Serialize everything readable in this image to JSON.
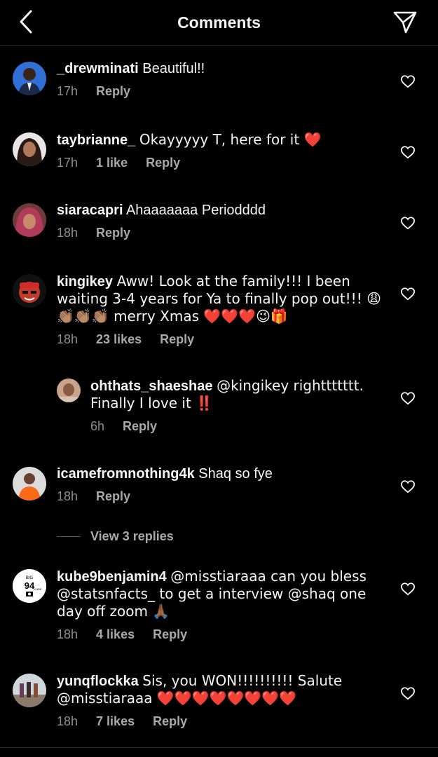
{
  "header": {
    "title": "Comments",
    "back_icon": "chevron-left-icon",
    "send_icon": "paper-plane-icon"
  },
  "comments": [
    {
      "username": "_drewminati",
      "text": "Beautiful!!",
      "time": "17h",
      "likes": "",
      "reply": "Reply"
    },
    {
      "username": "taybrianne_",
      "text": "Okayyyyy T, here for it ❤️",
      "time": "17h",
      "likes": "1 like",
      "reply": "Reply"
    },
    {
      "username": "siaracapri",
      "text": "Ahaaaaaaa Periodddd",
      "time": "18h",
      "likes": "",
      "reply": "Reply"
    },
    {
      "username": "kingikey",
      "text": "Aww! Look at the family!!! I been waiting 3-4 years for Ya to finally pop out!!! 😩 👏🏽👏🏽👏🏽 merry Xmas ❤️❤️❤️😉🎁",
      "time": "18h",
      "likes": "23 likes",
      "reply": "Reply"
    },
    {
      "username": "ohthats_shaeshae",
      "text": "@kingikey righttttttt. Finally I love it ‼️",
      "time": "6h",
      "likes": "",
      "reply": "Reply"
    },
    {
      "username": "icamefromnothing4k",
      "text": "Shaq so fye",
      "time": "18h",
      "likes": "",
      "reply": "Reply"
    },
    {
      "username": "kube9benjamin4",
      "text": "@misstiaraaa can you bless @statsnfacts_ to get a interview @shaq one day off zoom 🙏🏾",
      "time": "18h",
      "likes": "4 likes",
      "reply": "Reply"
    },
    {
      "username": "yunqflockka",
      "text": "Sis, you WON!!!!!!!!!! Salute @misstiaraaa ❤️❤️❤️❤️❤️❤️❤️❤️",
      "time": "18h",
      "likes": "7 likes",
      "reply": "Reply"
    }
  ],
  "view_replies": "View 3 replies",
  "avatar_badge": {
    "top": "BIG",
    "number": "94",
    "side": "KUBE"
  },
  "colors": {
    "background": "#000000",
    "text": "#f5f5f5",
    "muted": "#8e8e8e",
    "heart_emoji": "#ff2d2d"
  }
}
